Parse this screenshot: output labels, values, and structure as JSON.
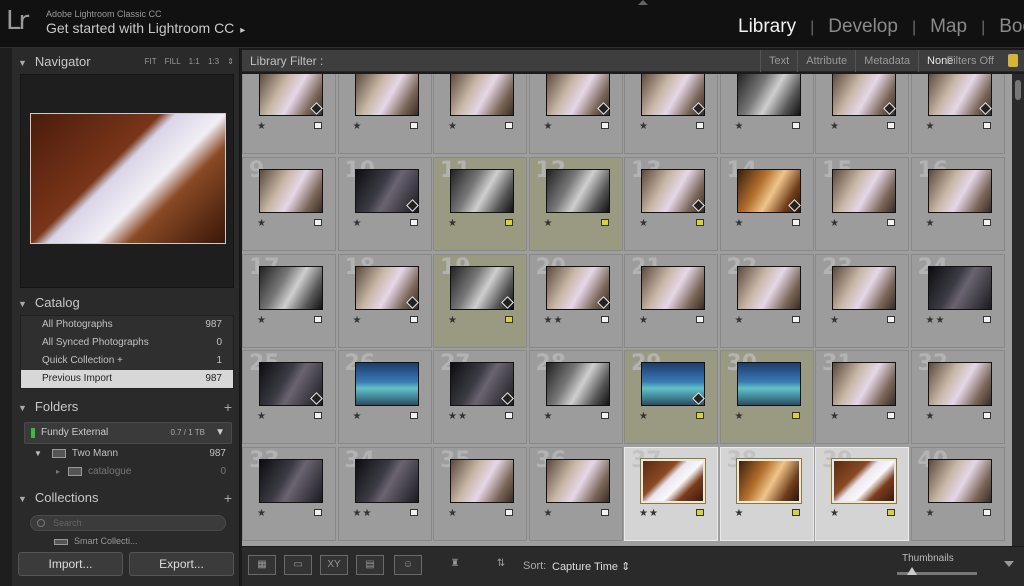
{
  "app": {
    "logo": "Lr",
    "subtitle": "Adobe Lightroom Classic CC",
    "title": "Get started with Lightroom CC",
    "title_arrow": "▸"
  },
  "modules": [
    {
      "label": "Library",
      "active": true
    },
    {
      "label": "Develop",
      "active": false
    },
    {
      "label": "Map",
      "active": false
    },
    {
      "label": "Boo",
      "active": false
    }
  ],
  "navigator": {
    "title": "Navigator",
    "zoom": "FIT FILL 1:1 1:3 ⇕"
  },
  "catalog": {
    "title": "Catalog",
    "items": [
      {
        "label": "All Photographs",
        "count": "987",
        "selected": false
      },
      {
        "label": "All Synced Photographs",
        "count": "0",
        "selected": false
      },
      {
        "label": "Quick Collection +",
        "count": "1",
        "selected": false
      },
      {
        "label": "Previous Import",
        "count": "987",
        "selected": true
      }
    ]
  },
  "folders": {
    "title": "Folders",
    "drive": {
      "name": "Fundy External",
      "size": "0.7 / 1 TB"
    },
    "items": [
      {
        "label": "Two Mann",
        "count": "987"
      },
      {
        "label": "catalogue",
        "count": "0"
      }
    ]
  },
  "collections": {
    "title": "Collections",
    "search_placeholder": "Search",
    "partial_item": "Smart Collecti..."
  },
  "buttons": {
    "import": "Import...",
    "export": "Export..."
  },
  "filter": {
    "label": "Library Filter :",
    "tabs": [
      "Text",
      "Attribute",
      "Metadata",
      "None"
    ],
    "selected": "None",
    "status": "Filters Off"
  },
  "grid": [
    {
      "n": "",
      "stars": 1,
      "flag": "w",
      "tone": "color",
      "sel": false,
      "badge": true
    },
    {
      "n": "",
      "stars": 1,
      "flag": "w",
      "tone": "color",
      "sel": false,
      "badge": false
    },
    {
      "n": "",
      "stars": 1,
      "flag": "w",
      "tone": "color",
      "sel": false,
      "badge": false
    },
    {
      "n": "",
      "stars": 1,
      "flag": "w",
      "tone": "color",
      "sel": false,
      "badge": true
    },
    {
      "n": "",
      "stars": 1,
      "flag": "w",
      "tone": "color",
      "sel": false,
      "badge": true
    },
    {
      "n": "",
      "stars": 1,
      "flag": "w",
      "tone": "bw",
      "sel": false,
      "badge": false
    },
    {
      "n": "",
      "stars": 1,
      "flag": "w",
      "tone": "color",
      "sel": false,
      "badge": true
    },
    {
      "n": "",
      "stars": 1,
      "flag": "w",
      "tone": "color",
      "sel": false,
      "badge": true
    },
    {
      "n": "9",
      "stars": 1,
      "flag": "w",
      "tone": "color",
      "sel": false,
      "badge": false
    },
    {
      "n": "10",
      "stars": 1,
      "flag": "w",
      "tone": "dark",
      "sel": false,
      "badge": true
    },
    {
      "n": "11",
      "stars": 1,
      "flag": "y",
      "tone": "bw",
      "sel": true,
      "badge": false
    },
    {
      "n": "12",
      "stars": 1,
      "flag": "y",
      "tone": "bw",
      "sel": true,
      "badge": false
    },
    {
      "n": "13",
      "stars": 1,
      "flag": "y",
      "tone": "color",
      "sel": false,
      "badge": true
    },
    {
      "n": "14",
      "stars": 1,
      "flag": "w",
      "tone": "warm",
      "sel": false,
      "badge": true
    },
    {
      "n": "15",
      "stars": 1,
      "flag": "w",
      "tone": "color",
      "sel": false,
      "badge": false
    },
    {
      "n": "16",
      "stars": 1,
      "flag": "w",
      "tone": "color",
      "sel": false,
      "badge": false
    },
    {
      "n": "17",
      "stars": 1,
      "flag": "w",
      "tone": "bw",
      "sel": false,
      "badge": false
    },
    {
      "n": "18",
      "stars": 1,
      "flag": "w",
      "tone": "color",
      "sel": false,
      "badge": true
    },
    {
      "n": "19",
      "stars": 1,
      "flag": "y",
      "tone": "bw",
      "sel": true,
      "badge": true
    },
    {
      "n": "20",
      "stars": 2,
      "flag": "w",
      "tone": "color",
      "sel": false,
      "badge": true
    },
    {
      "n": "21",
      "stars": 1,
      "flag": "w",
      "tone": "color",
      "sel": false,
      "badge": false
    },
    {
      "n": "22",
      "stars": 1,
      "flag": "w",
      "tone": "color",
      "sel": false,
      "badge": false
    },
    {
      "n": "23",
      "stars": 1,
      "flag": "w",
      "tone": "color",
      "sel": false,
      "badge": false
    },
    {
      "n": "24",
      "stars": 2,
      "flag": "w",
      "tone": "dark",
      "sel": false,
      "badge": false
    },
    {
      "n": "25",
      "stars": 1,
      "flag": "w",
      "tone": "dark",
      "sel": false,
      "badge": true
    },
    {
      "n": "26",
      "stars": 1,
      "flag": "w",
      "tone": "sea",
      "sel": false,
      "badge": false
    },
    {
      "n": "27",
      "stars": 2,
      "flag": "w",
      "tone": "dark",
      "sel": false,
      "badge": true
    },
    {
      "n": "28",
      "stars": 1,
      "flag": "w",
      "tone": "bw",
      "sel": false,
      "badge": false
    },
    {
      "n": "29",
      "stars": 1,
      "flag": "y",
      "tone": "sea",
      "sel": true,
      "badge": true
    },
    {
      "n": "30",
      "stars": 1,
      "flag": "y",
      "tone": "sea",
      "sel": true,
      "badge": false
    },
    {
      "n": "31",
      "stars": 1,
      "flag": "w",
      "tone": "color",
      "sel": false,
      "badge": false
    },
    {
      "n": "32",
      "stars": 1,
      "flag": "w",
      "tone": "color",
      "sel": false,
      "badge": false
    },
    {
      "n": "33",
      "stars": 1,
      "flag": "w",
      "tone": "dark",
      "sel": false,
      "badge": false
    },
    {
      "n": "34",
      "stars": 2,
      "flag": "w",
      "tone": "dark",
      "sel": false,
      "badge": false
    },
    {
      "n": "35",
      "stars": 1,
      "flag": "w",
      "tone": "color",
      "sel": false,
      "badge": false
    },
    {
      "n": "36",
      "stars": 1,
      "flag": "w",
      "tone": "color",
      "sel": false,
      "badge": false
    },
    {
      "n": "37",
      "stars": 2,
      "flag": "y",
      "tone": "paper",
      "sel": false,
      "active": true,
      "badge": false
    },
    {
      "n": "38",
      "stars": 1,
      "flag": "y",
      "tone": "warm",
      "sel": false,
      "active": true,
      "badge": false
    },
    {
      "n": "39",
      "stars": 1,
      "flag": "y",
      "tone": "paper",
      "sel": false,
      "active": true,
      "badge": false
    },
    {
      "n": "40",
      "stars": 1,
      "flag": "w",
      "tone": "color",
      "sel": false,
      "badge": false
    }
  ],
  "toolbar": {
    "sort_label": "Sort:",
    "sort_value": "Capture Time ⇕",
    "thumbnails_label": "Thumbnails",
    "thumbnails_level": 0.15
  },
  "colors": {
    "selected_cell": "#9a9a82",
    "active_cell": "#d4d4d4",
    "flag_yellow": "#d8d23a"
  }
}
